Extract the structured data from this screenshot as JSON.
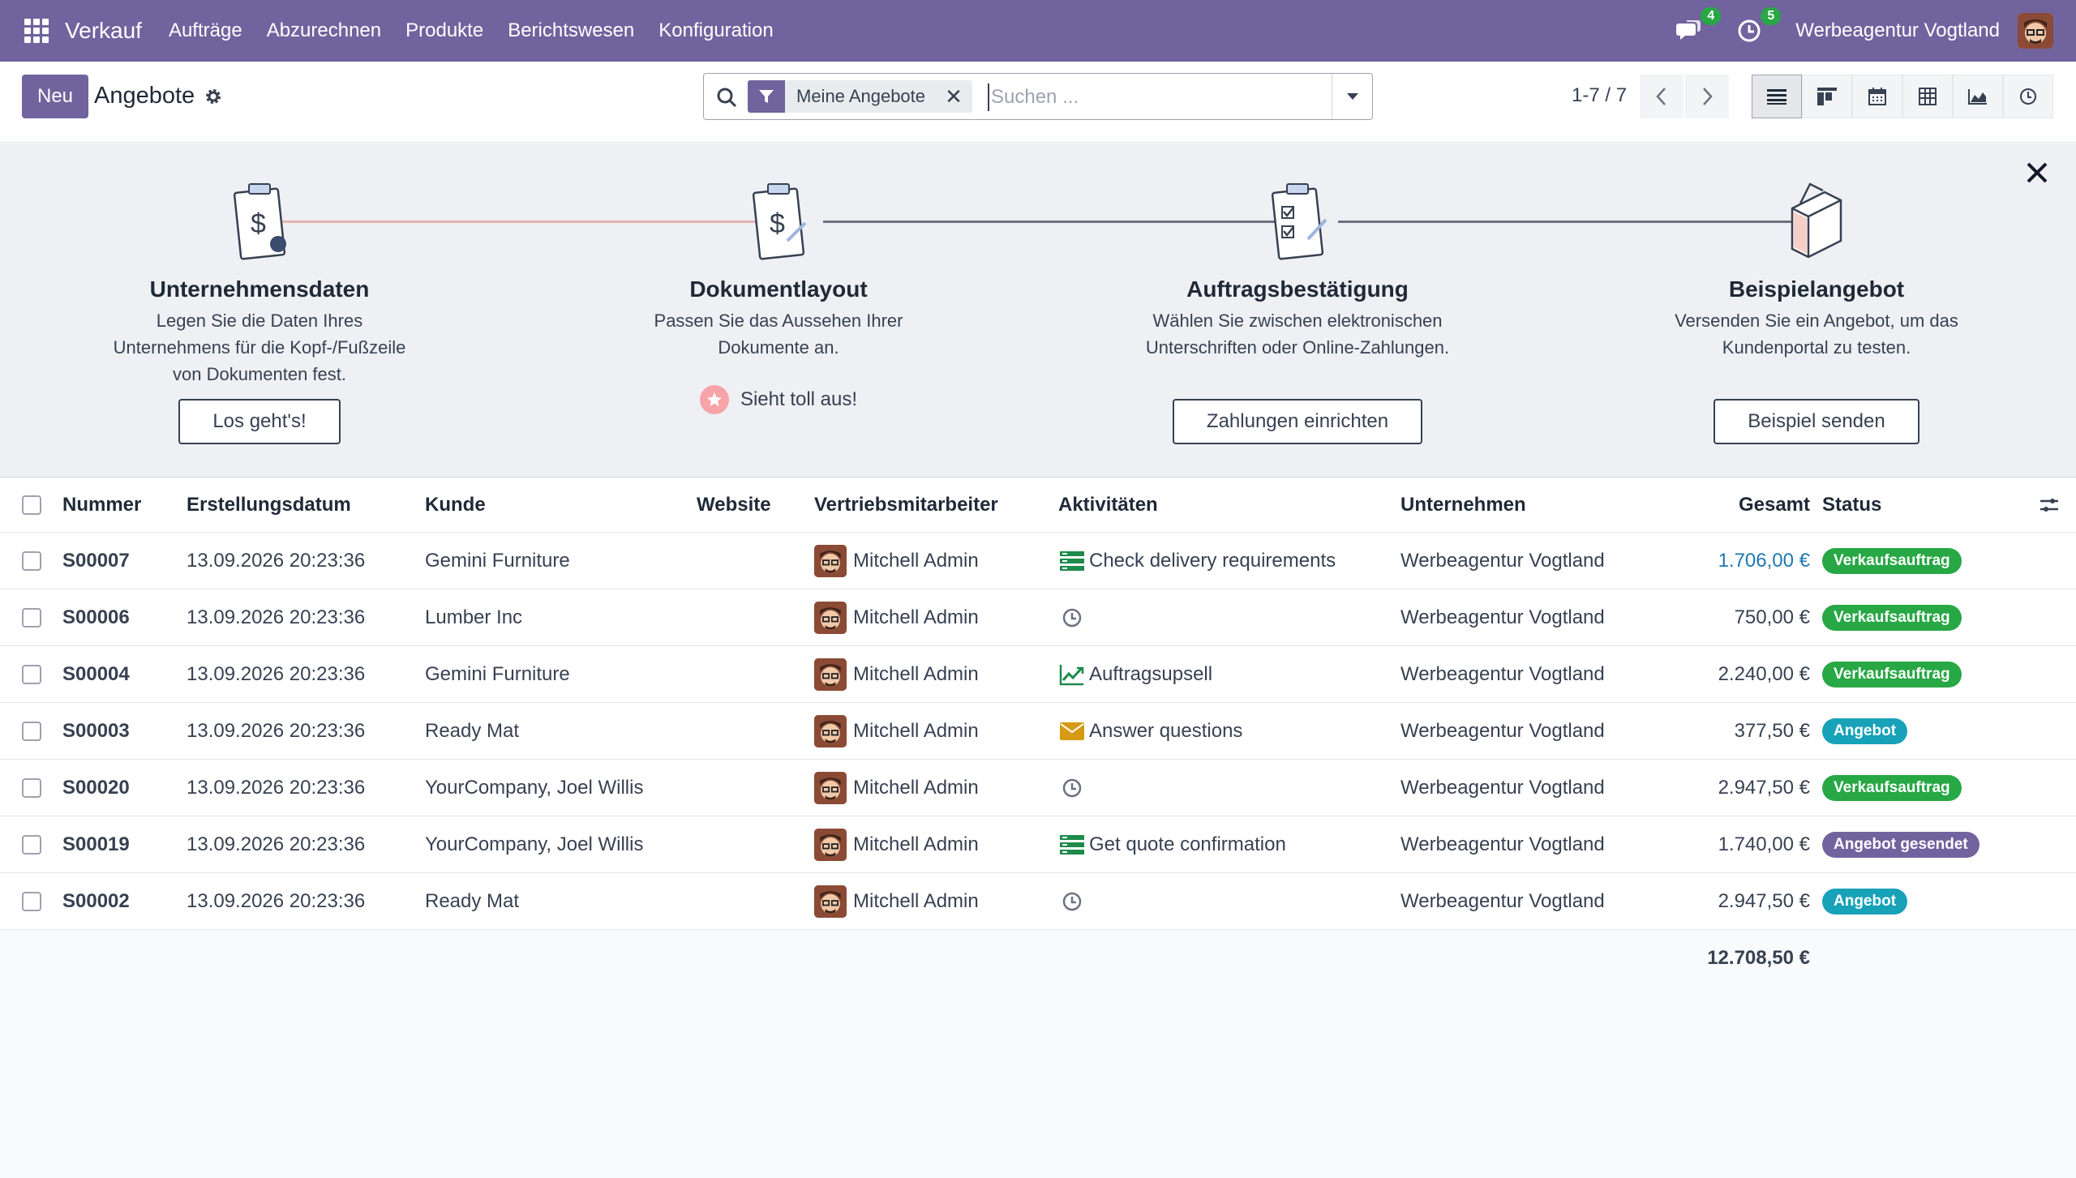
{
  "navbar": {
    "app_name": "Verkauf",
    "menu": [
      "Aufträge",
      "Abzurechnen",
      "Produkte",
      "Berichtswesen",
      "Konfiguration"
    ],
    "messages_count": "4",
    "activities_count": "5",
    "company": "Werbeagentur Vogtland",
    "accent_color": "#71639e"
  },
  "control": {
    "new_label": "Neu",
    "title": "Angebote",
    "facet_label": "Meine Angebote",
    "search_placeholder": "Suchen ...",
    "pager": "1-7 / 7",
    "views": [
      "list-view",
      "kanban-view",
      "calendar-view",
      "pivot-view",
      "graph-view",
      "activity-view"
    ]
  },
  "onboarding": {
    "steps": [
      {
        "title": "Unternehmensdaten",
        "desc": [
          "Legen Sie die Daten Ihres",
          "Unternehmens für die Kopf-/Fußzeile",
          "von Dokumenten fest."
        ],
        "button": "Los geht's!"
      },
      {
        "title": "Dokumentlayout",
        "desc": [
          "Passen Sie das Aussehen Ihrer",
          "Dokumente an."
        ],
        "done": "Sieht toll aus!"
      },
      {
        "title": "Auftragsbestätigung",
        "desc": [
          "Wählen Sie zwischen elektronischen",
          "Unterschriften oder Online-Zahlungen."
        ],
        "button": "Zahlungen einrichten"
      },
      {
        "title": "Beispielangebot",
        "desc": [
          "Versenden Sie ein Angebot, um das",
          "Kundenportal zu testen."
        ],
        "button": "Beispiel senden"
      }
    ]
  },
  "table": {
    "columns": [
      "Nummer",
      "Erstellungsdatum",
      "Kunde",
      "Website",
      "Vertriebsmitarbeiter",
      "Aktivitäten",
      "Unternehmen",
      "Gesamt",
      "Status"
    ],
    "rows": [
      {
        "number": "S00007",
        "date": "13.09.2026 20:23:36",
        "customer": "Gemini Furniture",
        "website": "",
        "salesperson": "Mitchell Admin",
        "activity": "Check delivery requirements",
        "activity_icon": "todo-icon",
        "company": "Werbeagentur Vogtland",
        "total": "1.706,00 €",
        "status": "Verkaufsauftrag"
      },
      {
        "number": "S00006",
        "date": "13.09.2026 20:23:36",
        "customer": "Lumber Inc",
        "website": "",
        "salesperson": "Mitchell Admin",
        "activity": "",
        "activity_icon": "clock-icon",
        "company": "Werbeagentur Vogtland",
        "total": "750,00 €",
        "status": "Verkaufsauftrag"
      },
      {
        "number": "S00004",
        "date": "13.09.2026 20:23:36",
        "customer": "Gemini Furniture",
        "website": "",
        "salesperson": "Mitchell Admin",
        "activity": "Auftragsupsell",
        "activity_icon": "upsell-chart-icon",
        "company": "Werbeagentur Vogtland",
        "total": "2.240,00 €",
        "status": "Verkaufsauftrag"
      },
      {
        "number": "S00003",
        "date": "13.09.2026 20:23:36",
        "customer": "Ready Mat",
        "website": "",
        "salesperson": "Mitchell Admin",
        "activity": "Answer questions",
        "activity_icon": "envelope-icon",
        "company": "Werbeagentur Vogtland",
        "total": "377,50 €",
        "status": "Angebot"
      },
      {
        "number": "S00020",
        "date": "13.09.2026 20:23:36",
        "customer": "YourCompany, Joel Willis",
        "website": "",
        "salesperson": "Mitchell Admin",
        "activity": "",
        "activity_icon": "clock-icon",
        "company": "Werbeagentur Vogtland",
        "total": "2.947,50 €",
        "status": "Verkaufsauftrag"
      },
      {
        "number": "S00019",
        "date": "13.09.2026 20:23:36",
        "customer": "YourCompany, Joel Willis",
        "website": "",
        "salesperson": "Mitchell Admin",
        "activity": "Get quote confirmation",
        "activity_icon": "todo-icon",
        "company": "Werbeagentur Vogtland",
        "total": "1.740,00 €",
        "status": "Angebot gesendet"
      },
      {
        "number": "S00002",
        "date": "13.09.2026 20:23:36",
        "customer": "Ready Mat",
        "website": "",
        "salesperson": "Mitchell Admin",
        "activity": "",
        "activity_icon": "clock-icon",
        "company": "Werbeagentur Vogtland",
        "total": "2.947,50 €",
        "status": "Angebot"
      }
    ],
    "grand_total": "12.708,50 €"
  },
  "colors": {
    "status_order": "#28a745",
    "status_quote": "#17a2b8",
    "status_sent": "#71639e",
    "link_amount": "#1f77b4"
  }
}
